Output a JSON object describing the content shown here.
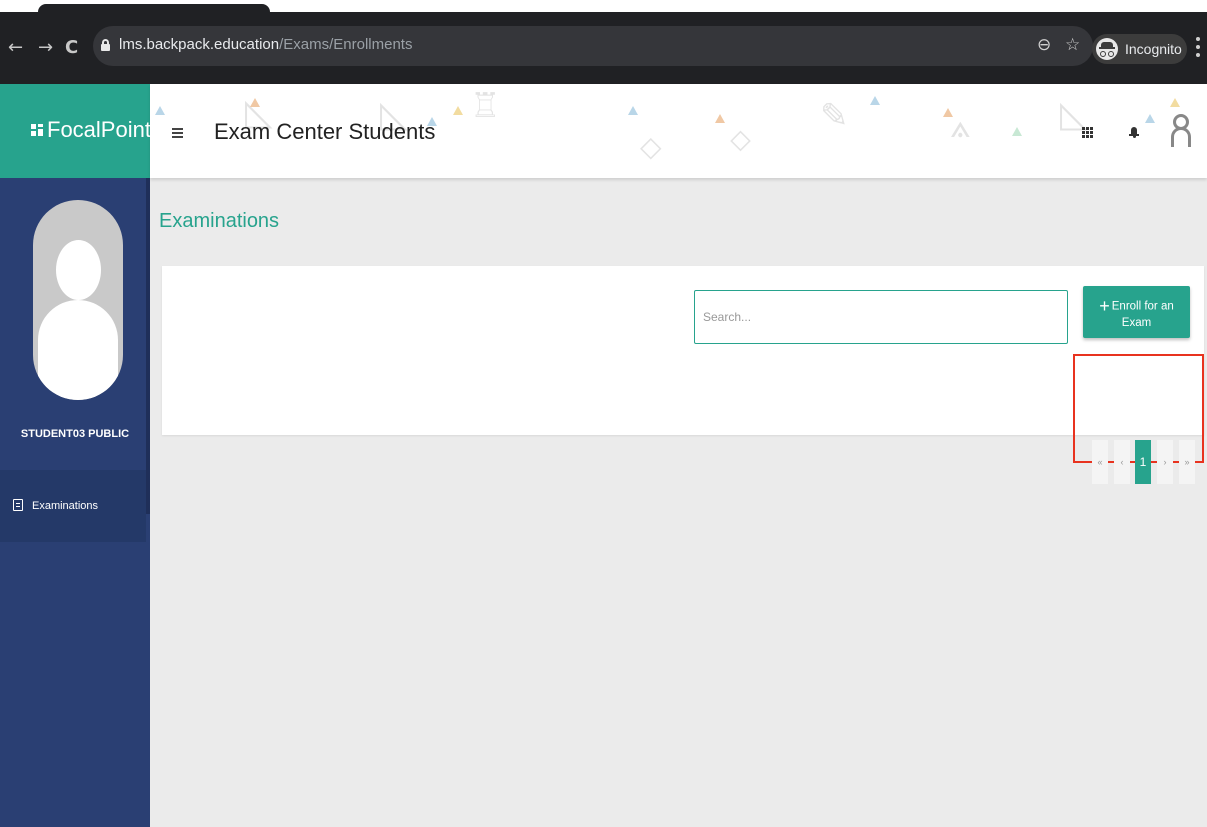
{
  "browser": {
    "url_host": "lms.backpack.education",
    "url_path": "/Exams/Enrollments",
    "back": "←",
    "forward": "→",
    "reload": "C",
    "zoom_icon": "zoom-icon",
    "star_icon": "star-icon",
    "profile_label": "Incognito"
  },
  "brand": {
    "name": "FocalPoint",
    "color": "#27a38d"
  },
  "header": {
    "title": "Exam Center Students"
  },
  "sidebar": {
    "user_name": "STUDENT03 PUBLIC",
    "items": [
      {
        "label": "Examinations",
        "icon": "document-icon"
      }
    ],
    "color": "#2a3f73"
  },
  "main": {
    "section_title": "Examinations",
    "search": {
      "placeholder": "Search...",
      "value": ""
    },
    "enroll_button": {
      "label": "Enroll for an Exam",
      "icon": "plus-icon"
    },
    "pagination": {
      "first": "«",
      "prev": "‹",
      "current": "1",
      "next": "›",
      "last": "»"
    }
  },
  "annotation_color": "#e8331f"
}
